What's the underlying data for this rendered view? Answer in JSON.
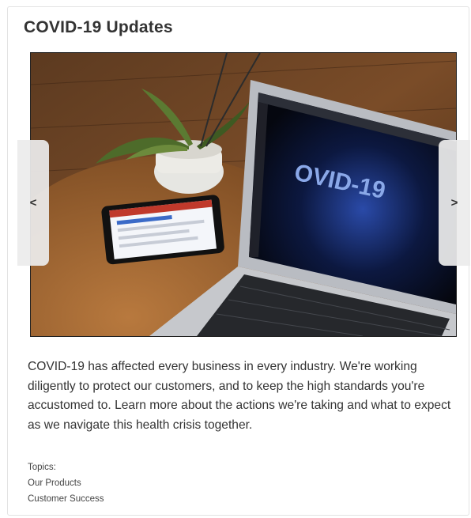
{
  "card": {
    "title": "COVID-19 Updates",
    "description": "COVID-19 has affected every business in every industry. We're working diligently to protect our customers, and to keep the high standards you're accustomed to. Learn more about the actions we're taking and what to expect as we navigate this health crisis together.",
    "topics_label": "Topics:",
    "topics": [
      "Our Products",
      "Customer Success"
    ]
  },
  "carousel": {
    "prev_icon": "chevron-left-icon",
    "next_icon": "chevron-right-icon",
    "prev_glyph": "<",
    "next_glyph": ">",
    "slide_screen_text": "OVID-19"
  },
  "colors": {
    "title": "#333333",
    "text": "#333333",
    "nav_bg": "#ececec"
  }
}
